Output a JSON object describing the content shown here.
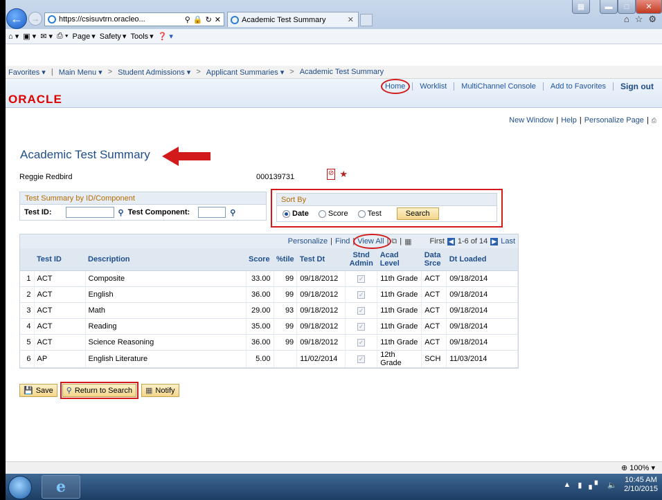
{
  "browser": {
    "url": "https://csisuvtrn.oracleo...",
    "active_tab_title": "Academic Test Summary",
    "command_bar": [
      "Page",
      "Safety",
      "Tools"
    ]
  },
  "nav": {
    "favorites": "Favorites",
    "main_menu": "Main Menu",
    "crumbs": [
      "Student Admissions",
      "Applicant Summaries",
      "Academic Test Summary"
    ]
  },
  "header": {
    "logo": "ORACLE",
    "links": [
      "Home",
      "Worklist",
      "MultiChannel Console",
      "Add to Favorites",
      "Sign out"
    ]
  },
  "page_links": [
    "New Window",
    "Help",
    "Personalize Page"
  ],
  "page": {
    "title": "Academic Test Summary",
    "student_name": "Reggie Redbird",
    "student_id": "000139731"
  },
  "summary_panel": {
    "header": "Test Summary by ID/Component",
    "test_id_label": "Test ID:",
    "test_component_label": "Test Component:"
  },
  "sort_panel": {
    "header": "Sort By",
    "options": [
      "Date",
      "Score",
      "Test"
    ],
    "selected": "Date",
    "search_button": "Search"
  },
  "grid": {
    "nav": {
      "personalize": "Personalize",
      "find": "Find",
      "view_all": "View All",
      "first": "First",
      "range": "1-6 of 14",
      "last": "Last"
    },
    "columns": [
      "Test ID",
      "Description",
      "Score",
      "%tile",
      "Test Dt",
      "Stnd Admin",
      "Acad Level",
      "Data Srce",
      "Dt Loaded"
    ],
    "rows": [
      {
        "n": "1",
        "test_id": "ACT",
        "desc": "Composite",
        "score": "33.00",
        "pct": "99",
        "test_dt": "09/18/2012",
        "acad": "11th Grade",
        "srce": "ACT",
        "loaded": "09/18/2014"
      },
      {
        "n": "2",
        "test_id": "ACT",
        "desc": "English",
        "score": "36.00",
        "pct": "99",
        "test_dt": "09/18/2012",
        "acad": "11th Grade",
        "srce": "ACT",
        "loaded": "09/18/2014"
      },
      {
        "n": "3",
        "test_id": "ACT",
        "desc": "Math",
        "score": "29.00",
        "pct": "93",
        "test_dt": "09/18/2012",
        "acad": "11th Grade",
        "srce": "ACT",
        "loaded": "09/18/2014"
      },
      {
        "n": "4",
        "test_id": "ACT",
        "desc": "Reading",
        "score": "35.00",
        "pct": "99",
        "test_dt": "09/18/2012",
        "acad": "11th Grade",
        "srce": "ACT",
        "loaded": "09/18/2014"
      },
      {
        "n": "5",
        "test_id": "ACT",
        "desc": "Science Reasoning",
        "score": "36.00",
        "pct": "99",
        "test_dt": "09/18/2012",
        "acad": "11th Grade",
        "srce": "ACT",
        "loaded": "09/18/2014"
      },
      {
        "n": "6",
        "test_id": "AP",
        "desc": "English Literature",
        "score": "5.00",
        "pct": "",
        "test_dt": "11/02/2014",
        "acad": "12th Grade",
        "srce": "SCH",
        "loaded": "11/03/2014"
      }
    ]
  },
  "buttons": {
    "save": "Save",
    "return": "Return to Search",
    "notify": "Notify"
  },
  "status_bar": {
    "zoom": "100%"
  },
  "taskbar": {
    "time": "10:45 AM",
    "date": "2/10/2015"
  },
  "colors": {
    "annotation_red": "#d21a1a",
    "link_blue": "#1f4e8c",
    "oracle_red": "#dd0000"
  }
}
